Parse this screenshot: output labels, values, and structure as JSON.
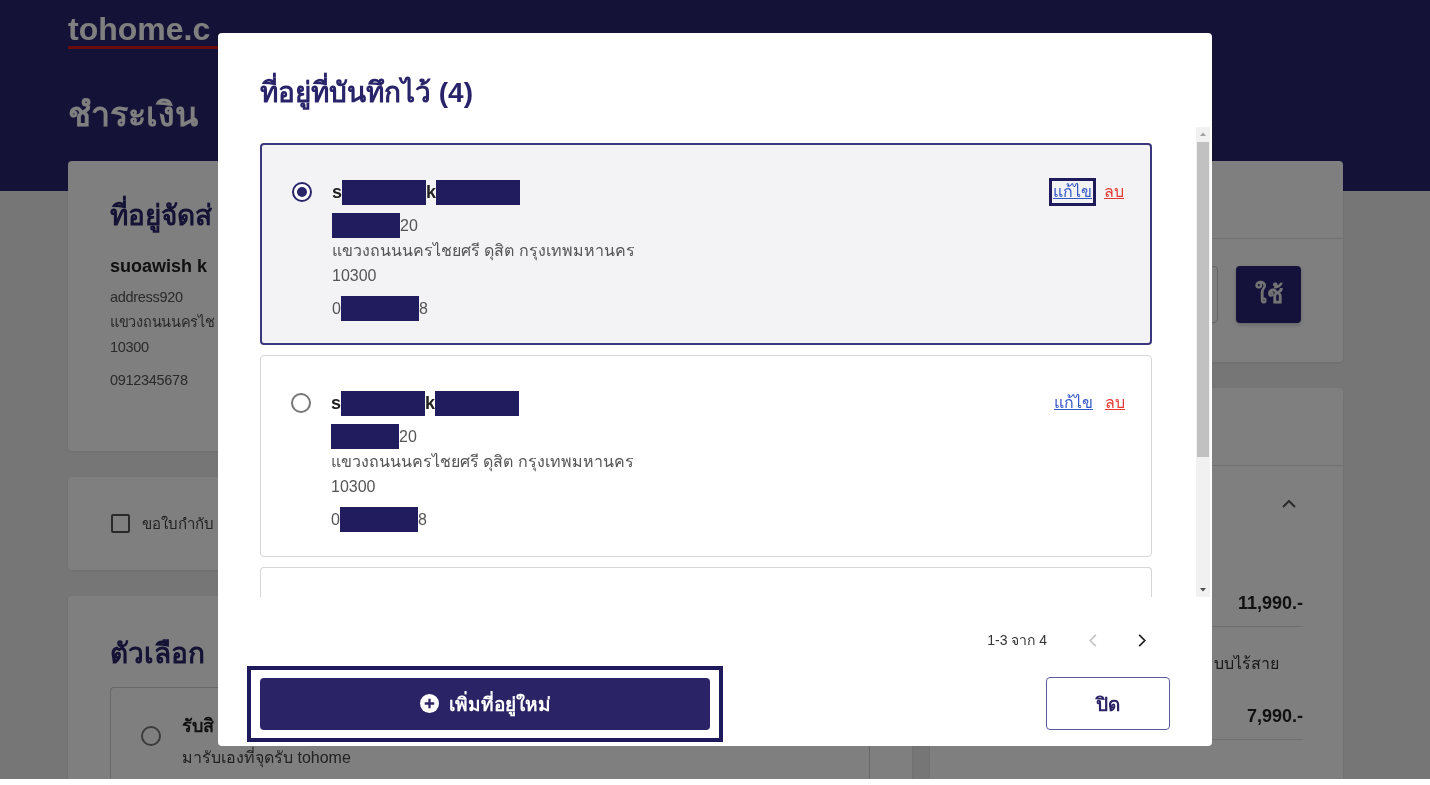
{
  "site": {
    "logo": "tohome.c"
  },
  "page_title": "ชำระเงิน",
  "shipping_card": {
    "title": "ที่อยู่จัดส่",
    "name": "suoawish k",
    "address_lines": [
      "address920",
      "แขวงถนนนครไช",
      "10300"
    ],
    "phone": "0912345678"
  },
  "tax_invoice": {
    "label": "ขอใบกำกับ",
    "checked": false
  },
  "delivery_options": {
    "title": "ตัวเลือก",
    "options": [
      {
        "title": "รับสิ",
        "description": "มารับเองที่จุดรับ tohome",
        "selected": false
      }
    ]
  },
  "coupon": {
    "apply_button": "ใช้"
  },
  "summary": {
    "expanded": true,
    "items": [
      {
        "price": "11,990.-"
      },
      {
        "name": "บบไร้สาย",
        "price": "7,990.-"
      }
    ]
  },
  "modal": {
    "title": "ที่อยู่ที่บันทึกไว้ (4)",
    "addresses": [
      {
        "kind": "address",
        "selected": true,
        "name": [
          {
            "kind": "text",
            "text": "s"
          },
          {
            "kind": "redacted"
          },
          {
            "kind": "text",
            "text": "k"
          },
          {
            "kind": "redacted"
          }
        ],
        "lines": [
          [
            {
              "kind": "redacted"
            },
            {
              "kind": "text",
              "text": "20"
            }
          ],
          [
            {
              "kind": "text",
              "text": "แขวงถนนนครไชยศรี ดุสิต กรุงเทพมหานคร"
            }
          ],
          [
            {
              "kind": "text",
              "text": "10300"
            }
          ]
        ],
        "phone": [
          {
            "kind": "text",
            "text": "0"
          },
          {
            "kind": "redacted"
          },
          {
            "kind": "text",
            "text": "8"
          }
        ],
        "edit": {
          "label": "แก้ไข",
          "focused": true
        },
        "delete": {
          "label": "ลบ"
        }
      },
      {
        "kind": "address",
        "selected": false,
        "name": [
          {
            "kind": "text",
            "text": "s"
          },
          {
            "kind": "redacted"
          },
          {
            "kind": "text",
            "text": "k"
          },
          {
            "kind": "redacted"
          }
        ],
        "lines": [
          [
            {
              "kind": "redacted"
            },
            {
              "kind": "text",
              "text": "20"
            }
          ],
          [
            {
              "kind": "text",
              "text": "แขวงถนนนครไชยศรี ดุสิต กรุงเทพมหานคร"
            }
          ],
          [
            {
              "kind": "text",
              "text": "10300"
            }
          ]
        ],
        "phone": [
          {
            "kind": "text",
            "text": "0"
          },
          {
            "kind": "redacted"
          },
          {
            "kind": "text",
            "text": "8"
          }
        ],
        "edit": {
          "label": "แก้ไข",
          "focused": false
        },
        "delete": {
          "label": "ลบ"
        }
      },
      {
        "kind": "partial"
      }
    ],
    "pagination": {
      "range": "1-3 จาก 4",
      "previous_disabled": true,
      "next_disabled": false
    },
    "add_button": {
      "label": "เพิ่มที่อยู่ใหม่",
      "focused": true
    },
    "close_button": {
      "label": "ปิด"
    }
  }
}
